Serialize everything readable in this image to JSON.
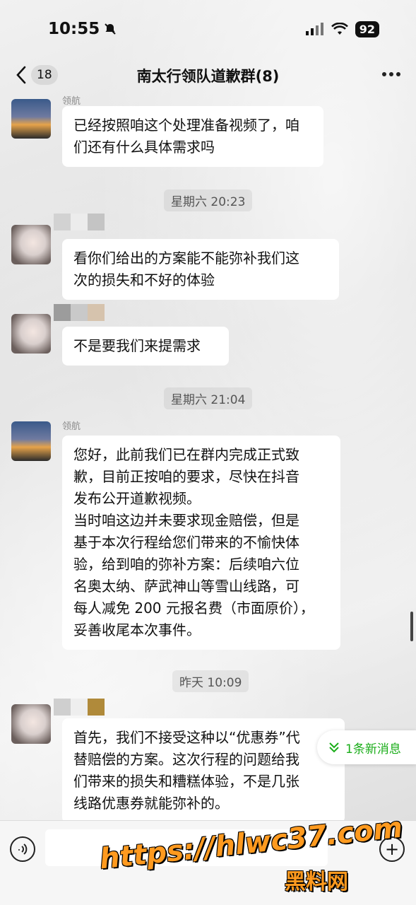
{
  "status_bar": {
    "time": "10:55",
    "battery": "92"
  },
  "header": {
    "unread_count": "18",
    "title": "南太行领队道歉群(8)"
  },
  "messages": [
    {
      "sender": "领航",
      "text_lines": [
        "已经按照咱这个处理准备视频了，咱",
        "们还有什么具体需求吗"
      ]
    },
    {
      "divider": "星期六 20:23"
    },
    {
      "text_lines": [
        "看你们给出的方案能不能弥补我们这",
        "次的损失和不好的体验"
      ]
    },
    {
      "text_lines": [
        "不是要我们来提需求"
      ]
    },
    {
      "divider": "星期六 21:04"
    },
    {
      "sender": "领航",
      "text_lines": [
        "您好，此前我们已在群内完成正式致",
        "歉，目前正按咱的要求，尽快在抖音",
        "发布公开道歉视频。",
        "当时咱这边并未要求现金赔偿，但是",
        "基于本次行程给您们带来的不愉快体",
        "验，给到咱的弥补方案：后续咱六位",
        "名奥太纳、萨武神山等雪山线路，可",
        "每人减免 200 元报名费（市面原价），",
        "妥善收尾本次事件。"
      ]
    },
    {
      "divider": "昨天 10:09"
    },
    {
      "text_lines": [
        "首先，我们不接受这种以“优惠券”代",
        "替赔偿的方案。这次行程的问题给我",
        "们带来的损失和糟糕体验，不是几张",
        "线路优惠券就能弥补的。"
      ]
    }
  ],
  "new_messages_pill": "1条新消息",
  "watermark": {
    "url": "https://hlwc37.com",
    "name": "黑料网"
  }
}
